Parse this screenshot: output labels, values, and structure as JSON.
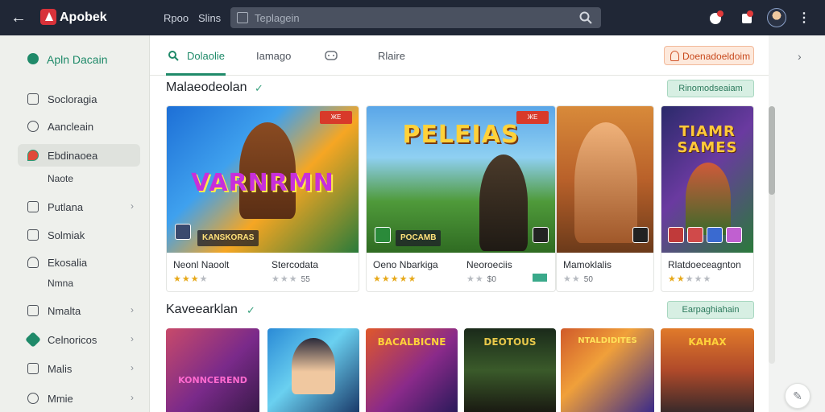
{
  "topbar": {
    "brand": "Apobek",
    "nav": [
      "Rpoo",
      "Slins"
    ],
    "search_placeholder": "Teplagein"
  },
  "sidebar": {
    "app_label": "Apln Dacain",
    "items": [
      {
        "label": "Socloragia",
        "chevron": false
      },
      {
        "label": "Aancleain",
        "chevron": false
      },
      {
        "label": "Ebdinaoea",
        "chevron": false,
        "active": true
      },
      {
        "label": "Putlana",
        "chevron": true
      },
      {
        "label": "Solmiak",
        "chevron": true
      },
      {
        "label": "Ekosalia",
        "chevron": false
      },
      {
        "label": "Nmalta",
        "chevron": true
      },
      {
        "label": "Celnoricos",
        "chevron": true
      },
      {
        "label": "Malis",
        "chevron": true
      },
      {
        "label": "Mmie",
        "chevron": true
      }
    ],
    "sub_items": [
      "Naote",
      "Nmna"
    ]
  },
  "tabs": {
    "items": [
      "Dolaolie",
      "Iamago",
      "",
      "Rlaire"
    ],
    "active_index": 0,
    "cta_label": "Doenadoeldoim"
  },
  "section1": {
    "title": "Malaeodeolan",
    "button": "Rinomodseaiam",
    "cards": [
      {
        "art_title": "VARNRMN",
        "banner": "KANSKORAS",
        "badge": "ЖЕ",
        "name": "Neonl Naoolt",
        "rating": 2.5
      },
      {
        "name": "Stercodata",
        "rating": 3,
        "rating_text": "55"
      },
      {
        "art_title": "PELEIAS",
        "banner": "POCAMB",
        "badge": "ЖЕ",
        "name": "Oeno Nbarkiga",
        "rating": 5
      },
      {
        "name": "Neoroeciis",
        "rating": 3,
        "rating_text": "$0"
      },
      {
        "name": "Mamoklalis",
        "rating": 3,
        "rating_text": "50"
      },
      {
        "art_title": "TIAMR SAMES",
        "name": "Rlatdoeceagnton",
        "rating": 2.5
      }
    ]
  },
  "section2": {
    "title": "Kaveearklan",
    "button": "Earpaghiahain",
    "thumbs": [
      "KONNCEREND",
      "",
      "BACALBICNE",
      "DEOTOUS",
      "NTALDIDITES",
      "KAHAX"
    ]
  },
  "colors": {
    "accent": "#1f8a69",
    "topbar": "#202736",
    "cta": "#c84a1e"
  }
}
